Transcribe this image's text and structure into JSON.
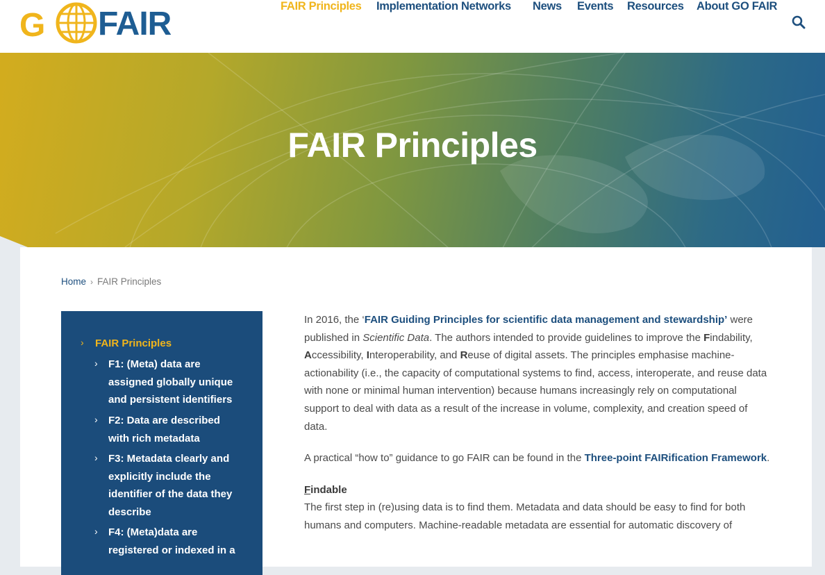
{
  "logo": {
    "left_text": "G",
    "right_text": "FAIR",
    "alt": "GO FAIR"
  },
  "nav": {
    "items": [
      {
        "label": "FAIR Principles",
        "active": true
      },
      {
        "label": "Implementation Networks",
        "active": false
      },
      {
        "label": "News",
        "active": false
      },
      {
        "label": "Events",
        "active": false
      },
      {
        "label": "Resources",
        "active": false
      },
      {
        "label": "About GO FAIR",
        "active": false
      }
    ],
    "search_icon": "search-icon"
  },
  "hero": {
    "title": "FAIR Principles"
  },
  "breadcrumb": {
    "home": "Home",
    "separator": "›",
    "current": "FAIR Principles"
  },
  "sidebar": {
    "items": [
      {
        "label": "FAIR Principles",
        "active": true
      },
      {
        "label_lines": [
          "F1: (Meta) data are",
          "assigned globally unique",
          "and persistent identifiers"
        ]
      },
      {
        "label_lines": [
          "F2: Data are described",
          "with rich metadata"
        ]
      },
      {
        "label_lines": [
          "F3: Metadata clearly and",
          "explicitly include the",
          "identifier of the data they",
          "describe"
        ]
      },
      {
        "label_lines": [
          "F4: (Meta)data are",
          "registered or indexed in a"
        ]
      }
    ]
  },
  "article": {
    "p1": {
      "t1": "In 2016, the ‘",
      "link": "FAIR Guiding Principles for scientific data management and stewardship’",
      "t2": " were published in ",
      "journal": "Scientific Data",
      "t3": ". The authors intended to provide guidelines to improve the ",
      "F": "F",
      "t4": "indability, ",
      "A": "A",
      "t5": "ccessibility, ",
      "I": "I",
      "t6": "nteroperability, and ",
      "R": "R",
      "t7": "euse of digital assets. The principles emphasise machine-actionability (i.e., the capacity of computational systems to find, access, interoperate, and reuse data with none or minimal human intervention) because humans increasingly rely on computational support to deal with data as a result of the increase in volume, complexity, and creation speed of data."
    },
    "p2": {
      "t1": "A practical “how to” guidance to go FAIR can be found in the ",
      "link": "Three-point FAIRification Framework",
      "t2": "."
    },
    "findable": {
      "F": "F",
      "rest": "indable"
    },
    "p3": "The first step in (re)using data is to find them. Metadata and data should be easy to find for both humans and computers. Machine-readable metadata are essential for automatic discovery of"
  },
  "colors": {
    "brand_blue": "#1d4f7e",
    "brand_yellow": "#f0b51c",
    "sidebar_bg": "#1b4c7b"
  }
}
